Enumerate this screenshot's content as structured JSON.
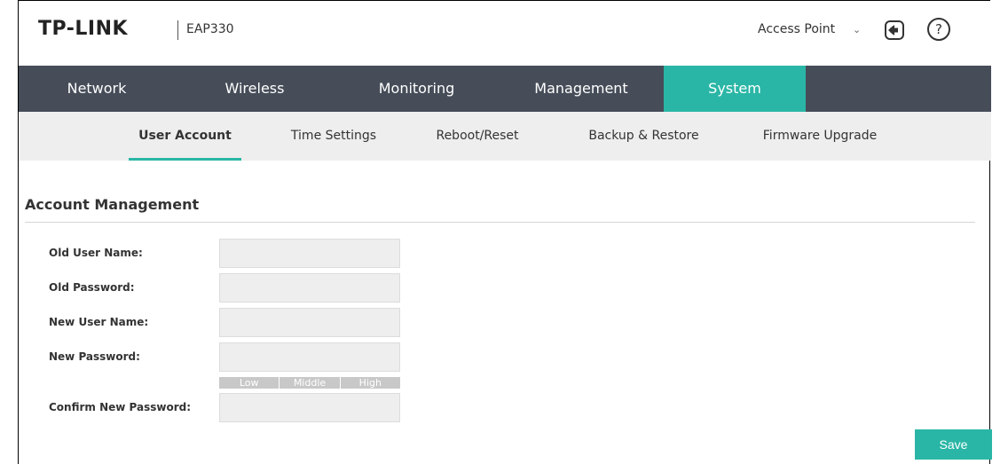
{
  "header": {
    "logo": "TP-LINK",
    "model": "EAP330",
    "mode": "Access Point",
    "help_symbol": "?",
    "icons": [
      "logout-icon",
      "help-icon",
      "chevron-down-icon"
    ]
  },
  "main_nav": [
    "Network",
    "Wireless",
    "Monitoring",
    "Management",
    "System"
  ],
  "main_nav_active": "System",
  "sub_nav": [
    "User Account",
    "Time Settings",
    "Reboot/Reset",
    "Backup & Restore",
    "Firmware Upgrade"
  ],
  "sub_nav_active": "User Account",
  "section": {
    "title": "Account Management",
    "fields": {
      "old_user_name": {
        "label": "Old User Name:",
        "value": ""
      },
      "old_password": {
        "label": "Old Password:",
        "value": ""
      },
      "new_user_name": {
        "label": "New User Name:",
        "value": ""
      },
      "new_password": {
        "label": "New Password:",
        "value": ""
      },
      "confirm_password": {
        "label": "Confirm New Password:",
        "value": ""
      }
    },
    "strength": [
      "Low",
      "Middle",
      "High"
    ]
  },
  "save_label": "Save",
  "colors": {
    "accent": "#2ab6a6",
    "nav_bg": "#464d59",
    "subnav_bg": "#eeeeee"
  }
}
